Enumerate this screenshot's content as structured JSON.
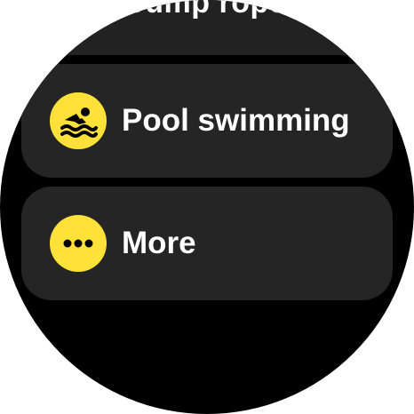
{
  "header": {
    "partial_title": "Jump rope"
  },
  "list": {
    "items": [
      {
        "label": "Pool swimming",
        "icon": "swimming-icon"
      },
      {
        "label": "More",
        "icon": "more-dots-icon"
      }
    ]
  },
  "colors": {
    "background": "#000000",
    "card": "#252525",
    "accent": "#ffe13a",
    "text": "#ffffff"
  }
}
